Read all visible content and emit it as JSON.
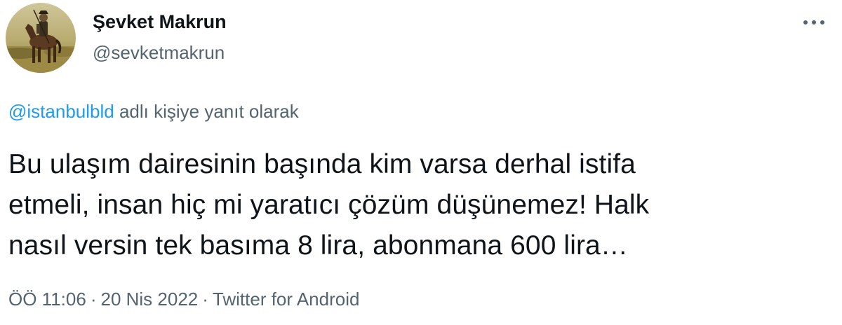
{
  "author": {
    "display_name": "Şevket Makrun",
    "handle": "@sevketmakrun",
    "avatar_icon": "horse-rider-avatar"
  },
  "menu": {
    "icon": "more-horizontal-icon"
  },
  "reply_context": {
    "mention": "@istanbulbld",
    "suffix": " adlı kişiye yanıt olarak"
  },
  "tweet": {
    "text_line_1": "Bu ulaşım dairesinin başında kim varsa derhal istifa",
    "text_line_2": "etmeli, insan hiç mi yaratıcı çözüm düşünemez! Halk",
    "text_line_3": "nasıl versin tek basıma 8 lira, abonmana 600 lira…"
  },
  "meta": {
    "time": "ÖÖ 11:06",
    "separator": "·",
    "date": "20 Nis 2022",
    "source": "Twitter for Android"
  },
  "colors": {
    "link": "#1d9bf0",
    "secondary_text": "#536471",
    "primary_text": "#0f1419"
  }
}
